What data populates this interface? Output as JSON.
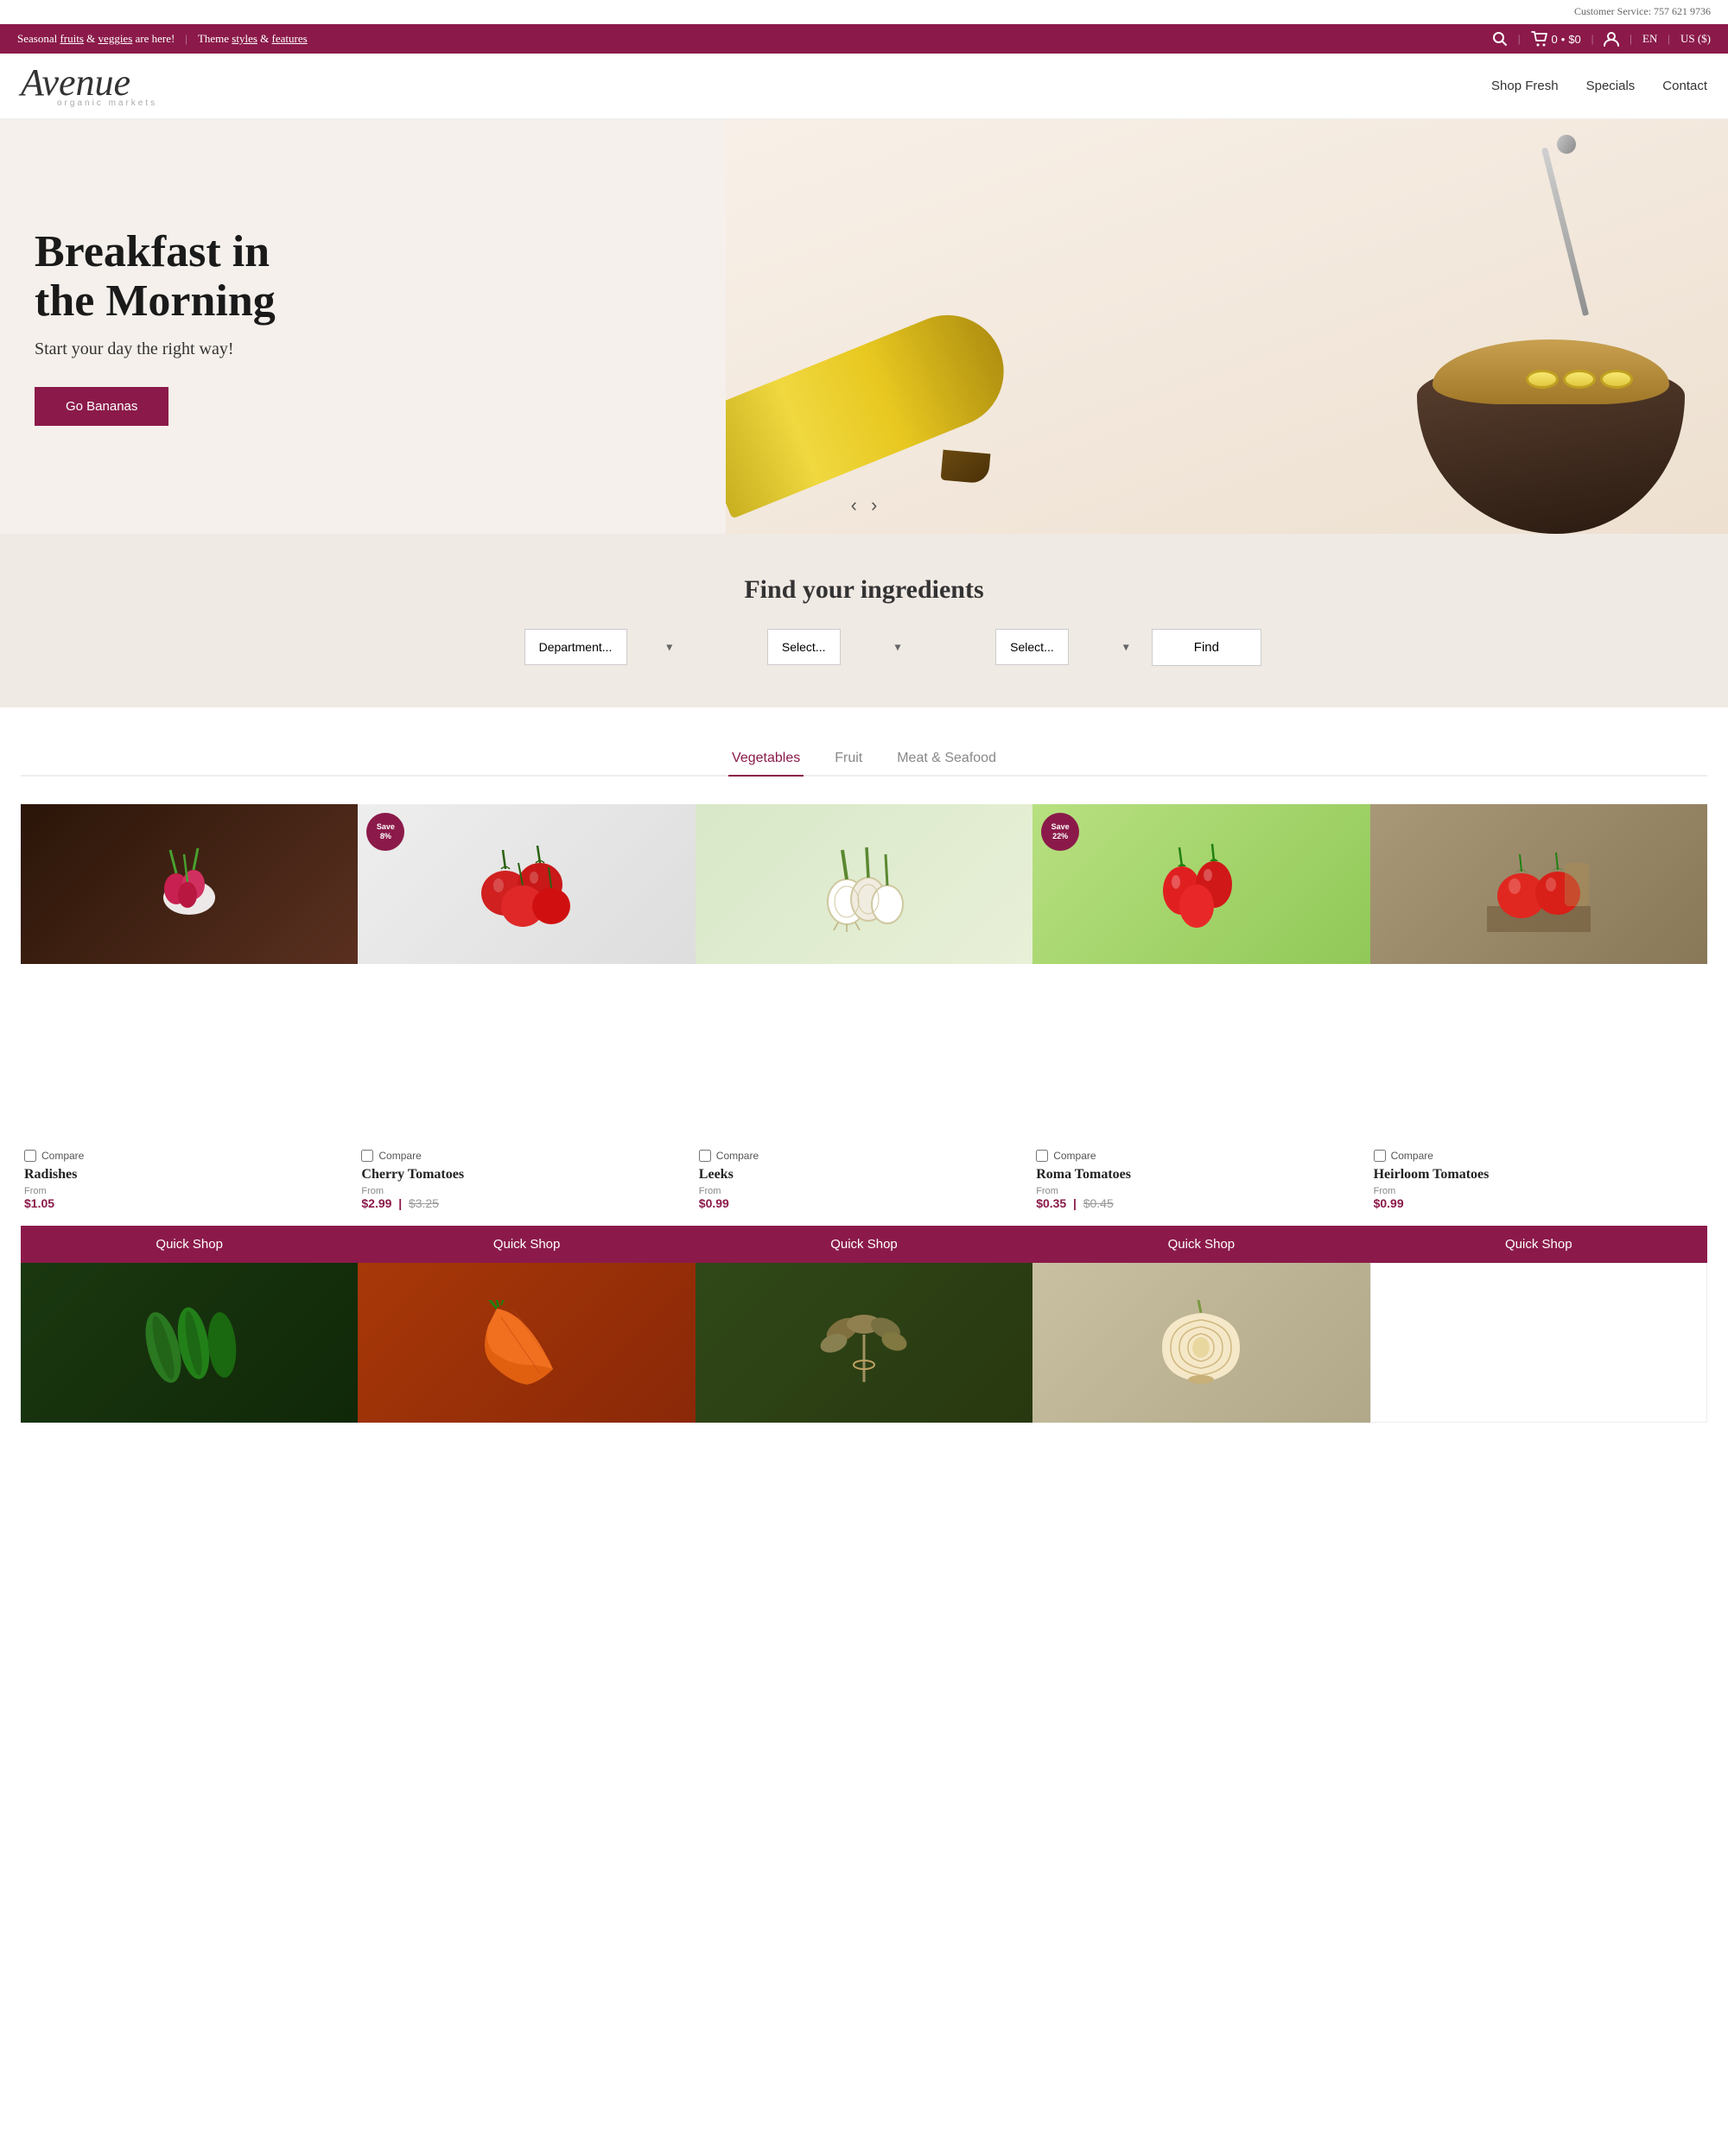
{
  "meta": {
    "customer_service_label": "Customer Service: 757 621 9736"
  },
  "announcement": {
    "text_pre": "Seasonal",
    "fruits_link": "fruits",
    "text_mid": " & ",
    "veggies_link": "veggies",
    "text_post": " are here!",
    "separator": "|",
    "theme_pre": "Theme",
    "styles_link": "styles",
    "and": "&",
    "features_link": "features"
  },
  "icons": {
    "search": "🔍",
    "cart": "🛒",
    "user": "👤",
    "chevron_down": "▾"
  },
  "cart": {
    "count": "0",
    "price": "$0"
  },
  "locale": {
    "language": "EN",
    "currency": "US ($)"
  },
  "logo": {
    "name": "Avenue",
    "tagline": "organic markets"
  },
  "nav": {
    "items": [
      {
        "label": "Shop Fresh",
        "href": "#"
      },
      {
        "label": "Specials",
        "href": "#"
      },
      {
        "label": "Contact",
        "href": "#"
      }
    ]
  },
  "hero": {
    "title": "Breakfast in the Morning",
    "subtitle": "Start your day the right way!",
    "cta_label": "Go Bananas",
    "nav_prev": "‹",
    "nav_next": "›"
  },
  "finder": {
    "title": "Find your ingredients",
    "dept_placeholder": "Department...",
    "select1_placeholder": "Select...",
    "select2_placeholder": "Select...",
    "find_btn": "Find"
  },
  "product_tabs": [
    {
      "label": "Vegetables",
      "active": true
    },
    {
      "label": "Fruit",
      "active": false
    },
    {
      "label": "Meat & Seafood",
      "active": false
    }
  ],
  "products_row1": [
    {
      "id": "radishes",
      "name": "Radishes",
      "from_label": "From",
      "price": "$1.05",
      "original_price": null,
      "save": null,
      "compare_label": "Compare",
      "quick_shop": "Quick Shop",
      "bg": "#4a2a18",
      "emoji": "🌿"
    },
    {
      "id": "cherry-tomatoes",
      "name": "Cherry Tomatoes",
      "from_label": "From",
      "price": "$2.99",
      "original_price": "$3.25",
      "save": "Save\n8%",
      "save_percent": "8%",
      "save_label": "Save",
      "compare_label": "Compare",
      "quick_shop": "Quick Shop",
      "bg": "#e8e0d8",
      "emoji": "🍅"
    },
    {
      "id": "leeks",
      "name": "Leeks",
      "from_label": "From",
      "price": "$0.99",
      "original_price": null,
      "save": null,
      "compare_label": "Compare",
      "quick_shop": "Quick Shop",
      "bg": "#dce8d0",
      "emoji": "🧅"
    },
    {
      "id": "roma-tomatoes",
      "name": "Roma Tomatoes",
      "from_label": "From",
      "price": "$0.35",
      "original_price": "$0.45",
      "save": "Save\n22%",
      "save_percent": "22%",
      "save_label": "Save",
      "compare_label": "Compare",
      "quick_shop": "Quick Shop",
      "bg": "#c8e0a0",
      "emoji": "🍅"
    },
    {
      "id": "heirloom-tomatoes",
      "name": "Heirloom Tomatoes",
      "from_label": "From",
      "price": "$0.99",
      "original_price": null,
      "save": null,
      "compare_label": "Compare",
      "quick_shop": "Quick Shop",
      "bg": "#b8a888",
      "emoji": "🍅"
    }
  ],
  "products_row2": [
    {
      "id": "zucchini",
      "bg": "#1a3a10",
      "emoji": "🥒"
    },
    {
      "id": "carrot",
      "bg": "#b04810",
      "emoji": "🥕"
    },
    {
      "id": "herbs",
      "bg": "#3a5020",
      "emoji": "🌿"
    },
    {
      "id": "onion",
      "bg": "#c8b898",
      "emoji": "🧅"
    },
    {
      "id": "empty",
      "bg": "#ffffff",
      "emoji": ""
    }
  ]
}
